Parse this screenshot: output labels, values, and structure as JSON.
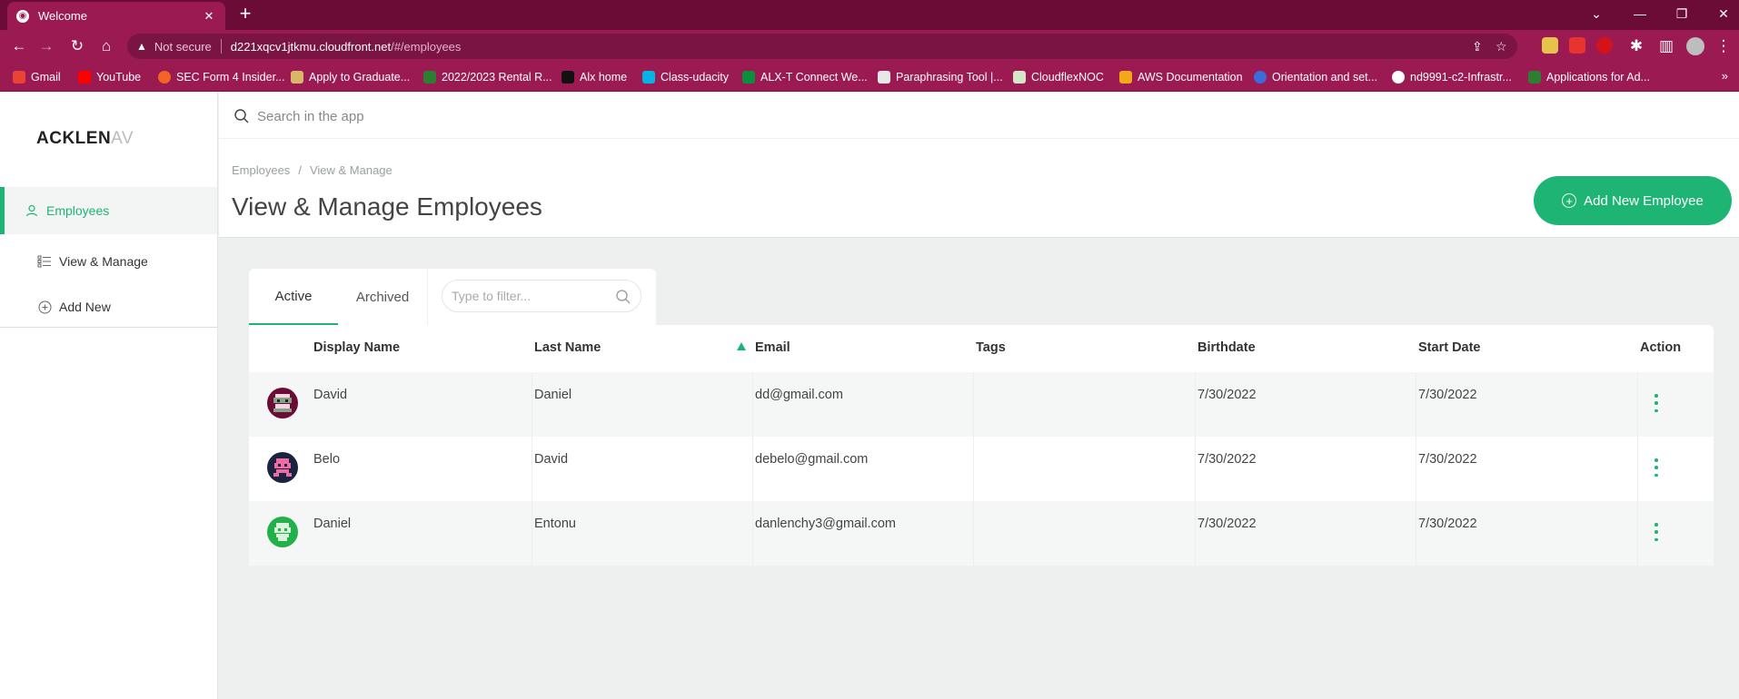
{
  "browser": {
    "tab_title": "Welcome",
    "tab_close": "✕",
    "new_tab": "+",
    "security_label": "Not secure",
    "url_host": "d221xqcv1jtkmu.cloudfront.net",
    "url_path": "/#/employees",
    "bookmarks": [
      {
        "label": "Gmail",
        "color": "#ea4335"
      },
      {
        "label": "YouTube",
        "color": "#ff0000"
      },
      {
        "label": "SEC Form 4 Insider...",
        "color": "#f26522"
      },
      {
        "label": "Apply to Graduate...",
        "color": "#d9b66a"
      },
      {
        "label": "2022/2023 Rental R...",
        "color": "#2f7d32"
      },
      {
        "label": "Alx home",
        "color": "#111111"
      },
      {
        "label": "Class-udacity",
        "color": "#02b3e4"
      },
      {
        "label": "ALX-T Connect We...",
        "color": "#0a8f3d"
      },
      {
        "label": "Paraphrasing Tool |...",
        "color": "#e8e8e8"
      },
      {
        "label": "CloudflexNOC",
        "color": "#d5e6c8"
      },
      {
        "label": "AWS Documentation",
        "color": "#f3a81a"
      },
      {
        "label": "Orientation and set...",
        "color": "#3b6cd8"
      },
      {
        "label": "nd9991-c2-Infrastr...",
        "color": "#ffffff"
      },
      {
        "label": "Applications for Ad...",
        "color": "#2f7d32"
      }
    ]
  },
  "app": {
    "logo_main": "ACKLEN",
    "logo_fade": "AV",
    "search_placeholder": "Search in the app",
    "sidebar": [
      {
        "label": "Employees",
        "icon": "user-icon"
      },
      {
        "label": "View & Manage",
        "icon": "list-icon"
      },
      {
        "label": "Add New",
        "icon": "plus-circle-icon"
      }
    ],
    "breadcrumb": [
      "Employees",
      "View & Manage"
    ],
    "breadcrumb_sep": "/",
    "page_title": "View & Manage Employees",
    "add_button": "Add New Employee",
    "tabs": [
      "Active",
      "Archived"
    ],
    "filter_placeholder": "Type to filter...",
    "columns": [
      "Display Name",
      "Last Name",
      "Email",
      "Tags",
      "Birthdate",
      "Start Date",
      "Action"
    ],
    "rows": [
      {
        "display_name": "David",
        "last_name": "Daniel",
        "email": "dd@gmail.com",
        "tags": "",
        "birthdate": "7/30/2022",
        "start_date": "7/30/2022",
        "avatar_color": "#6b0c37"
      },
      {
        "display_name": "Belo",
        "last_name": "David",
        "email": "debelo@gmail.com",
        "tags": "",
        "birthdate": "7/30/2022",
        "start_date": "7/30/2022",
        "avatar_color": "#1a2340"
      },
      {
        "display_name": "Daniel",
        "last_name": "Entonu",
        "email": "danlenchy3@gmail.com",
        "tags": "",
        "birthdate": "7/30/2022",
        "start_date": "7/30/2022",
        "avatar_color": "#22b04b"
      }
    ],
    "accent_color": "#1eb574"
  }
}
